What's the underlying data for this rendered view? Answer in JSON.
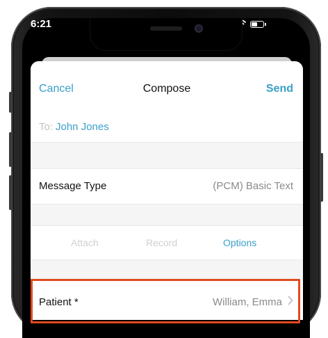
{
  "status_bar": {
    "time": "6:21",
    "icons": [
      "signal-icon",
      "wifi-icon",
      "battery-icon"
    ]
  },
  "nav": {
    "cancel_label": "Cancel",
    "title": "Compose",
    "send_label": "Send"
  },
  "recipient": {
    "label": "To:",
    "name": "John Jones"
  },
  "message_type": {
    "label": "Message Type",
    "value": "(PCM) Basic Text"
  },
  "actions": {
    "attach_label": "Attach",
    "record_label": "Record",
    "options_label": "Options"
  },
  "patient": {
    "label": "Patient *",
    "value": "William, Emma",
    "icon": "chevron-right-icon"
  },
  "colors": {
    "accent": "#3a9fc8",
    "highlight": "#e04a1f",
    "disabled": "#d0d0d0",
    "secondary_text": "#8a8a8a"
  }
}
